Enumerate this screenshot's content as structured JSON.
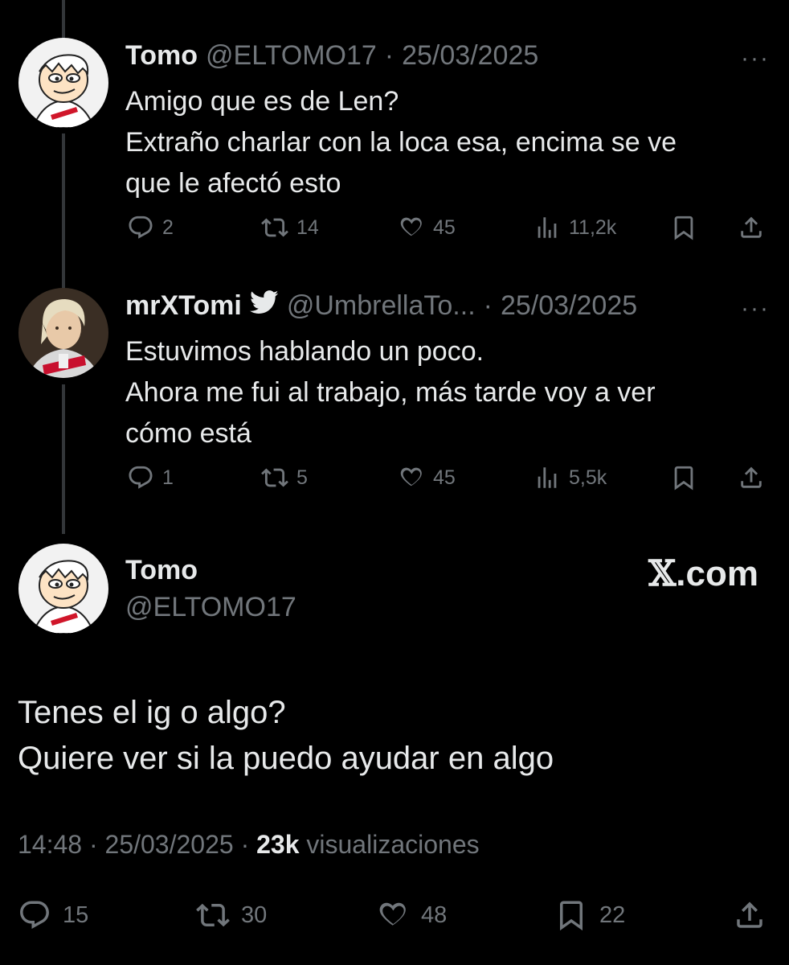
{
  "tweets": [
    {
      "name": "Tomo",
      "handle": "@ELTOMO17",
      "date": "25/03/2025",
      "lines": [
        "Amigo que es de Len?",
        "Extraño charlar con la loca esa, encima se ve",
        "que le afectó esto"
      ],
      "replies": "2",
      "retweets": "14",
      "likes": "45",
      "views": "11,2k"
    },
    {
      "name": "mrXTomi",
      "handle": "@UmbrellaTo...",
      "date": "25/03/2025",
      "lines": [
        "Estuvimos hablando un poco.",
        "Ahora me fui al trabajo, más tarde voy a ver",
        "cómo está"
      ],
      "replies": "1",
      "retweets": "5",
      "likes": "45",
      "views": "5,5k"
    }
  ],
  "main": {
    "name": "Tomo",
    "handle": "@ELTOMO17",
    "brand": ".com",
    "lines": [
      "Tenes el ig o algo?",
      "Quiere ver si la puedo ayudar en algo"
    ],
    "time": "14:48",
    "date": "25/03/2025",
    "views_count": "23k",
    "views_label": "visualizaciones",
    "replies": "15",
    "retweets": "30",
    "likes": "48",
    "bookmarks": "22"
  },
  "separator": "·",
  "more_glyph": "···",
  "icons": {
    "reply": "speech-bubble-icon",
    "retweet": "retweet-icon",
    "like": "heart-icon",
    "views": "bar-chart-icon",
    "bookmark": "bookmark-icon",
    "share": "share-icon",
    "verified": "twitter-bird-icon"
  },
  "colors": {
    "background": "#000000",
    "text": "#e7e9ea",
    "muted": "#71767b",
    "thread_line": "#333639"
  }
}
